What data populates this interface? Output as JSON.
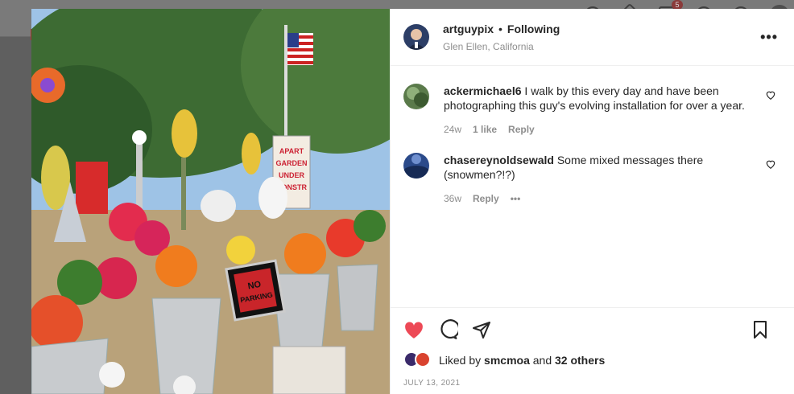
{
  "post": {
    "author": "artguypix",
    "separator": "•",
    "follow_status": "Following",
    "location": "Glen Ellen, California",
    "sign_text": "NO PARKING",
    "garden_sign": "APARTMENT GARDEN UNDER CONSTRUCTION"
  },
  "comments": [
    {
      "user": "ackermichael6",
      "text": "I walk by this every day and have been photographing this guy's evolving installation for over a year.",
      "age": "24w",
      "likes": "1 like",
      "reply": "Reply"
    },
    {
      "user": "chasereynoldsewald",
      "text": "Some mixed messages there (snowmen?!?)",
      "age": "36w",
      "reply": "Reply",
      "more": "•••"
    }
  ],
  "likes": {
    "prefix": "Liked by",
    "user": "smcmoa",
    "joiner": "and",
    "others": "32 others"
  },
  "date": "JULY 13, 2021",
  "header": {
    "more": "•••",
    "notification_count": "5"
  },
  "colors": {
    "liked_heart": "#ed4956",
    "text": "#262626",
    "muted": "#8e8e8e"
  }
}
